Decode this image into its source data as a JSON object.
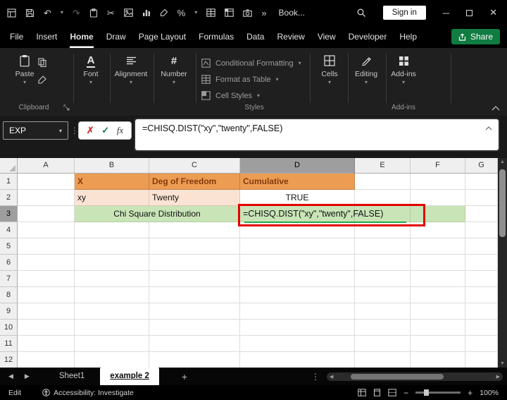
{
  "colors": {
    "titlebar_bg": "#000000",
    "ribbon_bg": "#1F1F1F",
    "share_green": "#107C41",
    "header_fill": "#ED9C53",
    "header_text": "#843C0C",
    "input_row_fill": "#FBE3D3",
    "result_row_fill": "#C9E5B8",
    "annotation_red": "#E30000",
    "selected_header_fill": "#9E9E9E"
  },
  "titlebar": {
    "workbook_name": "Book...",
    "sign_in_label": "Sign in"
  },
  "menubar": {
    "items": [
      "File",
      "Insert",
      "Home",
      "Draw",
      "Page Layout",
      "Formulas",
      "Data",
      "Review",
      "View",
      "Developer",
      "Help"
    ],
    "active_item": "Home",
    "share_label": "Share"
  },
  "ribbon": {
    "paste_label": "Paste",
    "font_label": "Font",
    "alignment_label": "Alignment",
    "number_label": "Number",
    "styles_items": [
      "Conditional Formatting",
      "Format as Table",
      "Cell Styles"
    ],
    "cells_label": "Cells",
    "editing_label": "Editing",
    "addins_label": "Add-ins",
    "group_labels": {
      "clipboard": "Clipboard",
      "styles": "Styles",
      "addins": "Add-ins"
    }
  },
  "formula_bar": {
    "name_box_value": "EXP",
    "formula": "=CHISQ.DIST(\"xy\",\"twenty\",FALSE)"
  },
  "grid": {
    "columns": [
      "A",
      "B",
      "C",
      "D",
      "E",
      "F",
      "G"
    ],
    "rows": [
      "1",
      "2",
      "3",
      "4",
      "5",
      "6",
      "7",
      "8",
      "9",
      "10",
      "11",
      "12"
    ],
    "selected_column": "D",
    "selected_row": "3",
    "cells": [
      {
        "ref": "B1",
        "col": "B",
        "row": 1,
        "text": "X",
        "cls": "orange",
        "align": "left"
      },
      {
        "ref": "C1",
        "col": "C",
        "row": 1,
        "text": "Deg of Freedom",
        "cls": "orange",
        "align": "left"
      },
      {
        "ref": "D1",
        "col": "D",
        "row": 1,
        "text": "Cumulative",
        "cls": "orange",
        "align": "left"
      },
      {
        "ref": "B2",
        "col": "B",
        "row": 2,
        "text": "xy",
        "cls": "peach",
        "align": "left"
      },
      {
        "ref": "C2",
        "col": "C",
        "row": 2,
        "text": "Twenty",
        "cls": "peach",
        "align": "left"
      },
      {
        "ref": "D2",
        "col": "D",
        "row": 2,
        "text": "TRUE",
        "cls": "plain",
        "align": "center"
      },
      {
        "ref": "B3",
        "col": "B",
        "row": 3,
        "colspan": 2,
        "text": "Chi Square Distribution",
        "cls": "green",
        "align": "center"
      },
      {
        "ref": "D3",
        "col": "D",
        "row": 3,
        "text": "=CHISQ.DIST(\"xy\",\"twenty\",FALSE)",
        "cls": "green formula",
        "align": "left"
      },
      {
        "ref": "E3",
        "col": "E",
        "row": 3,
        "text": "",
        "cls": "green"
      },
      {
        "ref": "F3",
        "col": "F",
        "row": 3,
        "text": "",
        "cls": "green"
      }
    ]
  },
  "sheetbar": {
    "tabs": [
      {
        "label": "Sheet1",
        "active": false
      },
      {
        "label": "example 2",
        "active": true
      }
    ],
    "add_tab": "+"
  },
  "statusbar": {
    "mode": "Edit",
    "accessibility": "Accessibility: Investigate",
    "zoom_level": "100%"
  },
  "icons": {
    "undo": "↶",
    "redo": "↷",
    "scissors": "✂",
    "percent": "%",
    "overflow": "»",
    "chevron_down": "▾",
    "dots_vertical": "⋮",
    "cancel": "✗",
    "check": "✓",
    "fx": "fx",
    "minimize": "─",
    "close": "✕",
    "nav_left": "◀",
    "nav_right": "▶",
    "scroll_up": "▲",
    "scroll_down": "▼",
    "zoom_out": "−",
    "zoom_in": "+",
    "number_icon": "#",
    "font_icon": "A"
  }
}
